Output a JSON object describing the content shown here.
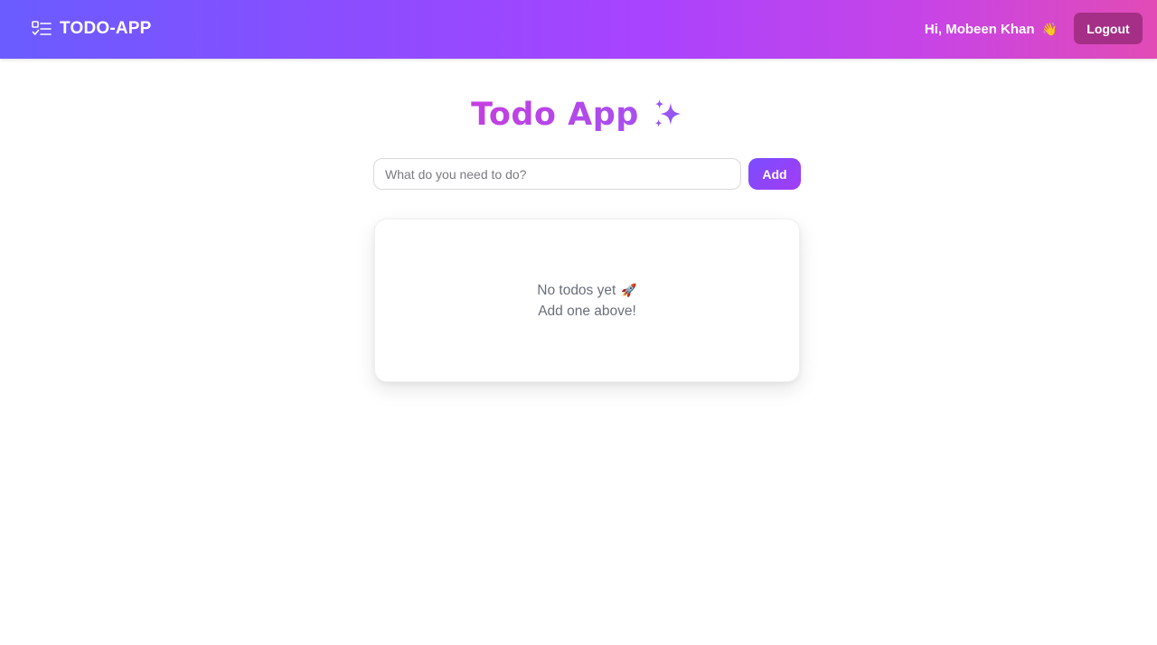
{
  "navbar": {
    "brand": "TODO-APP",
    "brand_icon": "checklist-icon",
    "greeting": "Hi, Mobeen Khan",
    "greeting_emoji": "👋",
    "logout_label": "Logout",
    "colors": {
      "gradient_start": "#6a5cff",
      "gradient_end": "#e24bb6",
      "logout_bg": "#a52f86"
    }
  },
  "main": {
    "title": "Todo App",
    "title_icon": "sparkles-icon",
    "input": {
      "placeholder": "What do you need to do?",
      "value": ""
    },
    "add_label": "Add",
    "empty_state": {
      "line1": "No todos yet",
      "line1_emoji": "🚀",
      "line2": "Add one above!"
    },
    "colors": {
      "accent": "#a843ff",
      "title": "#c43fe0"
    }
  }
}
